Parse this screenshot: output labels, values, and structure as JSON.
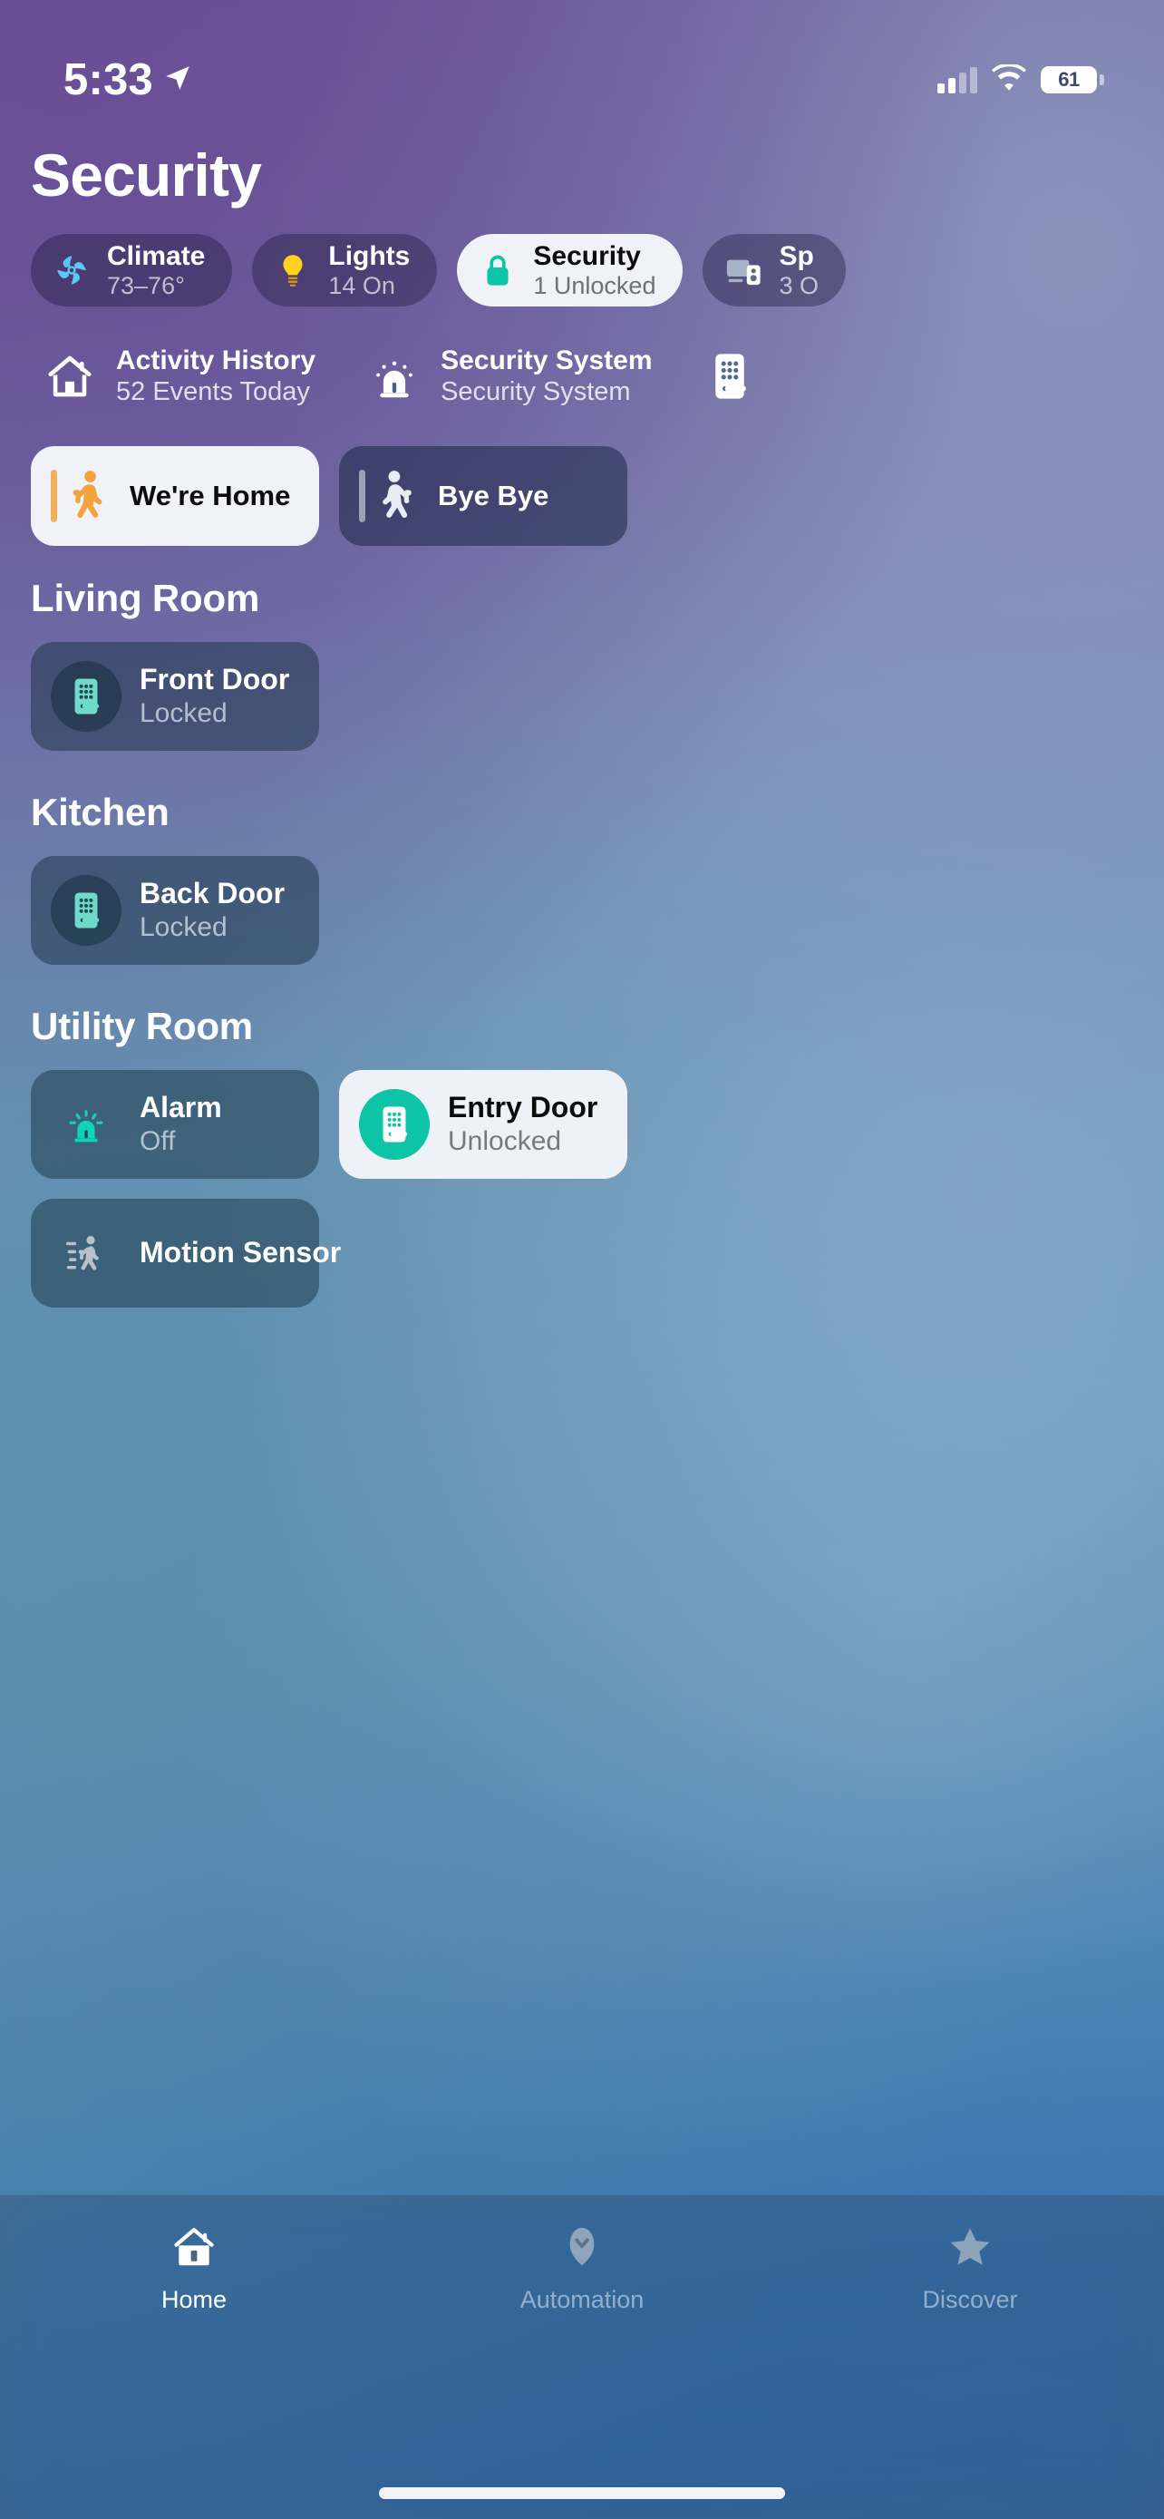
{
  "status_bar": {
    "time": "5:33",
    "location_icon": "location-arrow-icon",
    "cellular_icon": "cellular-signal-icon",
    "cellular_bars": 2,
    "wifi_icon": "wifi-icon",
    "battery_icon": "battery-icon",
    "battery_percent": "61"
  },
  "header": {
    "title": "Security"
  },
  "categories": [
    {
      "label": "Climate",
      "status": "73–76°",
      "icon": "fan-icon",
      "active": false,
      "accent": "#5ac8f5"
    },
    {
      "label": "Lights",
      "status": "14 On",
      "icon": "lightbulb-icon",
      "active": false,
      "accent": "#ffd21e"
    },
    {
      "label": "Security",
      "status": "1 Unlocked",
      "icon": "lock-icon",
      "active": true,
      "accent": "#0ec4a6"
    },
    {
      "label": "Sp",
      "status": "3 O",
      "icon": "speaker-icon",
      "active": false,
      "accent": "#a5b3c4"
    }
  ],
  "status_items": [
    {
      "title": "Activity History",
      "subtitle": "52 Events Today",
      "icon": "house-icon"
    },
    {
      "title": "Security System",
      "subtitle": "Security System",
      "icon": "siren-icon"
    },
    {
      "title": "",
      "subtitle": "",
      "icon": "door-lock-icon"
    }
  ],
  "scenes": [
    {
      "label": "We're Home",
      "icon": "person-walking-in-icon",
      "active": true
    },
    {
      "label": "Bye Bye",
      "icon": "person-walking-out-icon",
      "active": false
    }
  ],
  "rooms": [
    {
      "name": "Living Room",
      "tiles": [
        {
          "name": "Front Door",
          "status": "Locked",
          "icon": "door-lock-icon",
          "active": false
        }
      ]
    },
    {
      "name": "Kitchen",
      "tiles": [
        {
          "name": "Back Door",
          "status": "Locked",
          "icon": "door-lock-icon",
          "active": false
        }
      ]
    },
    {
      "name": "Utility Room",
      "tiles": [
        {
          "name": "Alarm",
          "status": "Off",
          "icon": "siren-icon",
          "active": false,
          "plain": true
        },
        {
          "name": "Entry Door",
          "status": "Unlocked",
          "icon": "door-lock-icon",
          "active": true
        },
        {
          "name": "Motion Sensor",
          "status": "",
          "icon": "motion-sensor-icon",
          "active": false,
          "plain": true
        }
      ]
    }
  ],
  "tab_bar": [
    {
      "label": "Home",
      "icon": "house-icon",
      "active": true
    },
    {
      "label": "Automation",
      "icon": "automation-icon",
      "active": false
    },
    {
      "label": "Discover",
      "icon": "star-icon",
      "active": false
    }
  ],
  "colors": {
    "accent_teal": "#0ec4a6",
    "accent_orange": "#f2a33c",
    "active_card": "#eef1f7"
  }
}
